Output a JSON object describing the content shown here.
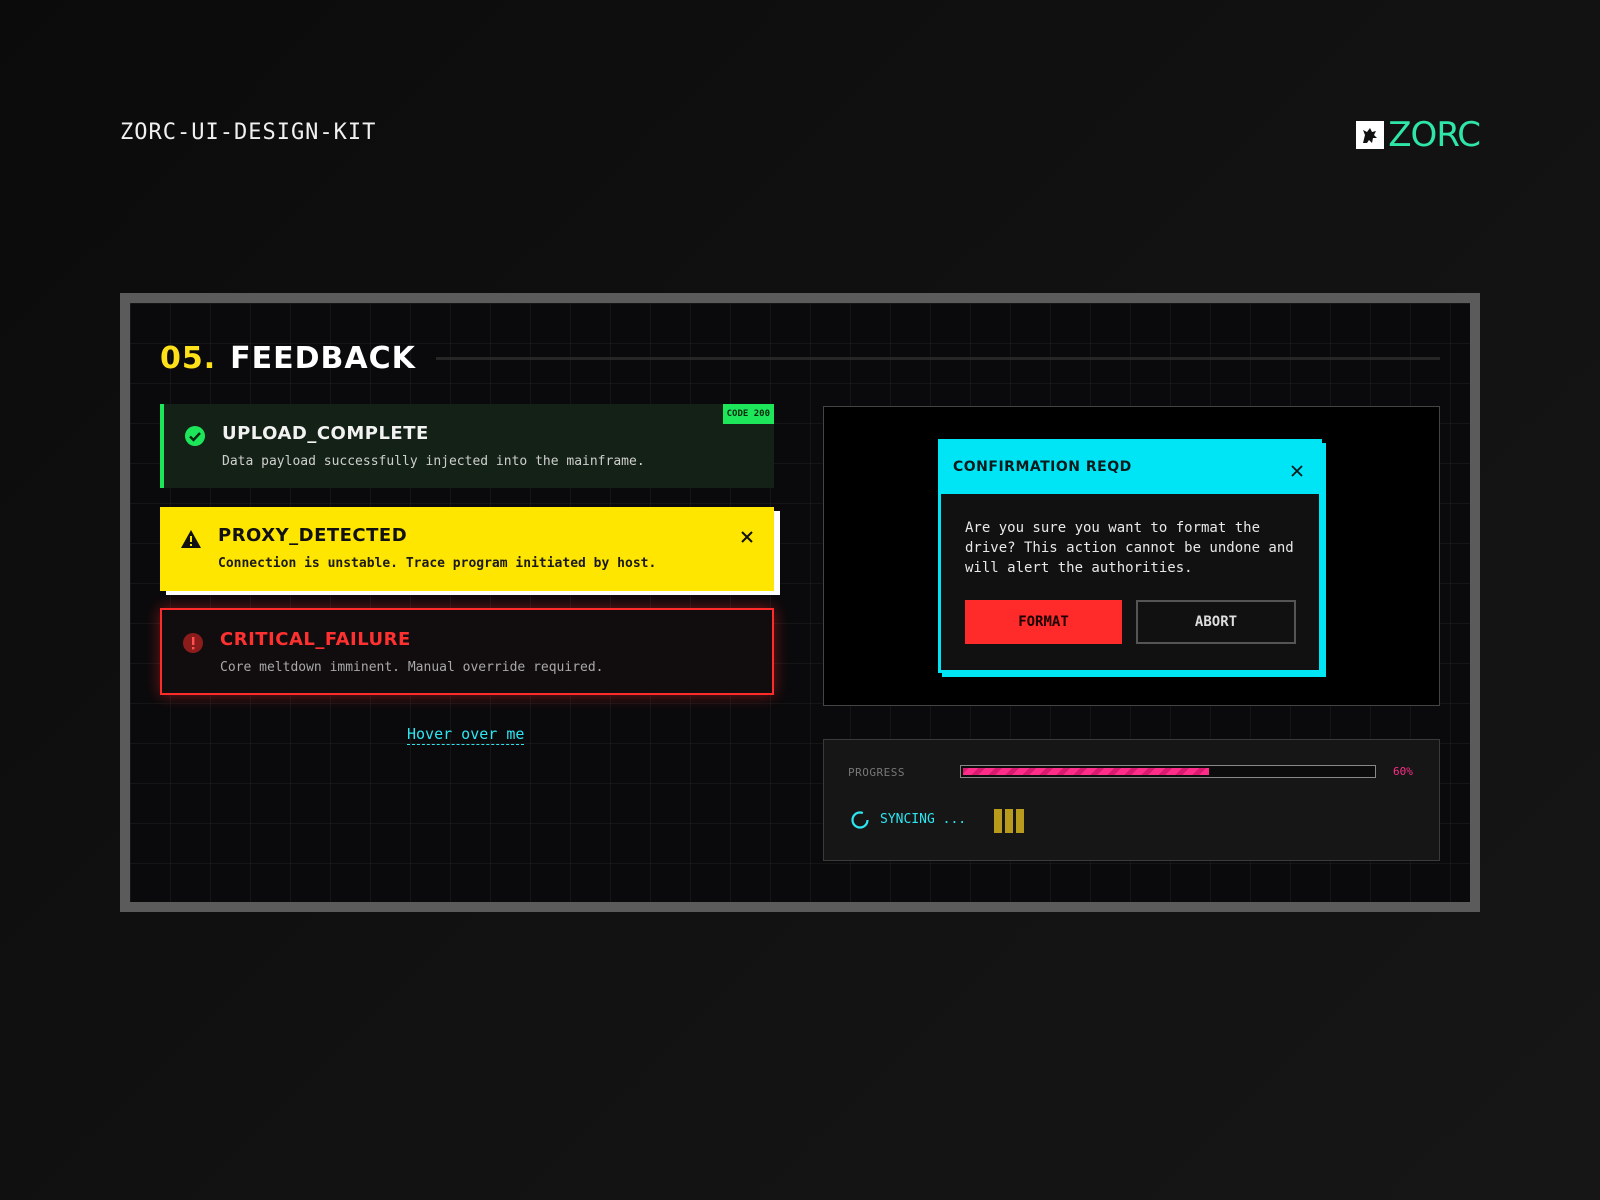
{
  "header": {
    "kit_title": "ZORC-UI-DESIGN-KIT",
    "brand": "ZORC",
    "brand_color": "#2ee6a6"
  },
  "section": {
    "number": "05.",
    "title": "FEEDBACK"
  },
  "alerts": {
    "success": {
      "icon": "check-circle-icon",
      "title": "UPLOAD_COMPLETE",
      "message": "Data payload successfully injected into the mainframe.",
      "badge": "CODE 200",
      "color": "#1ee65a"
    },
    "warning": {
      "icon": "warning-triangle-icon",
      "title": "PROXY_DETECTED",
      "message": "Connection is unstable. Trace program initiated by host.",
      "color": "#ffe600"
    },
    "error": {
      "icon": "alert-circle-icon",
      "title": "CRITICAL_FAILURE",
      "message": "Core meltdown imminent. Manual override required.",
      "color": "#ff2a2a"
    }
  },
  "hover_link": "Hover over me",
  "modal": {
    "title": "CONFIRMATION REQD",
    "body": "Are you sure you want to format the drive? This action cannot be undone and will alert the authorities.",
    "confirm_label": "FORMAT",
    "cancel_label": "ABORT",
    "accent": "#00e5f5"
  },
  "progress": {
    "label": "PROGRESS",
    "value": 0.6,
    "value_text": "60%",
    "color": "#ff2d8a",
    "sync_text": "SYNCING ..."
  }
}
